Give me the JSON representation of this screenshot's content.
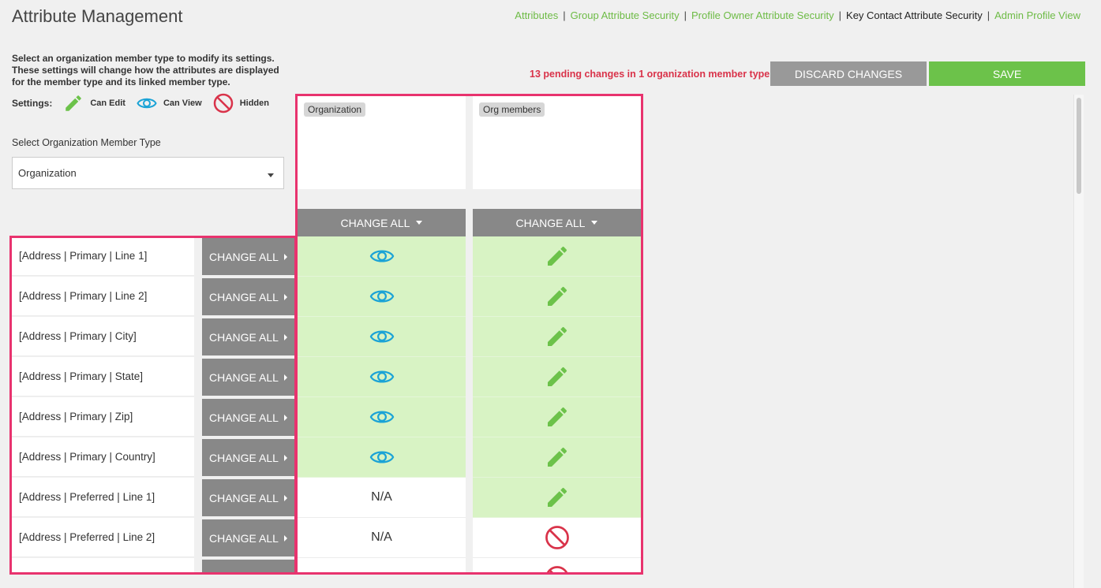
{
  "header": {
    "title": "Attribute Management",
    "nav": [
      {
        "label": "Attributes",
        "current": false
      },
      {
        "label": "Group Attribute Security",
        "current": false
      },
      {
        "label": "Profile Owner Attribute Security",
        "current": false
      },
      {
        "label": "Key Contact Attribute Security",
        "current": true
      },
      {
        "label": "Admin Profile View",
        "current": false
      }
    ],
    "separator": "|"
  },
  "intro": "Select an organization member type to modify its settings. These settings will change how the attributes are displayed for the member type and its linked member type.",
  "settings": {
    "label": "Settings:",
    "legend": [
      {
        "icon": "pencil-icon",
        "label": "Can Edit"
      },
      {
        "icon": "eye-icon",
        "label": "Can View"
      },
      {
        "icon": "hidden-icon",
        "label": "Hidden"
      }
    ]
  },
  "select": {
    "label": "Select Organization Member Type",
    "value": "Organization"
  },
  "actions": {
    "pending": "13 pending changes in 1 organization member type",
    "discard": "DISCARD CHANGES",
    "save": "SAVE"
  },
  "columns": [
    {
      "name": "Organization",
      "change_all": "CHANGE ALL"
    },
    {
      "name": "Org members",
      "change_all": "CHANGE ALL"
    }
  ],
  "row_change_all": "CHANGE ALL",
  "rows": [
    {
      "label": "[Address | Primary | Line 1]",
      "values": [
        "view",
        "edit"
      ]
    },
    {
      "label": "[Address | Primary | Line 2]",
      "values": [
        "view",
        "edit"
      ]
    },
    {
      "label": "[Address | Primary | City]",
      "values": [
        "view",
        "edit"
      ]
    },
    {
      "label": "[Address | Primary | State]",
      "values": [
        "view",
        "edit"
      ]
    },
    {
      "label": "[Address | Primary | Zip]",
      "values": [
        "view",
        "edit"
      ]
    },
    {
      "label": "[Address | Primary | Country]",
      "values": [
        "view",
        "edit"
      ]
    },
    {
      "label": "[Address | Preferred | Line 1]",
      "values": [
        "N/A",
        "edit"
      ]
    },
    {
      "label": "[Address | Preferred | Line 2]",
      "values": [
        "N/A",
        "hidden"
      ]
    },
    {
      "label": "",
      "values": [
        "",
        "hidden"
      ]
    }
  ],
  "colors": {
    "accent_green": "#6cc24a",
    "link_green": "#6dbb45",
    "eye_blue": "#1ba3d6",
    "hidden_red": "#d9334a",
    "highlight_pink": "#e8336e",
    "cell_green": "#d8f3c4"
  }
}
